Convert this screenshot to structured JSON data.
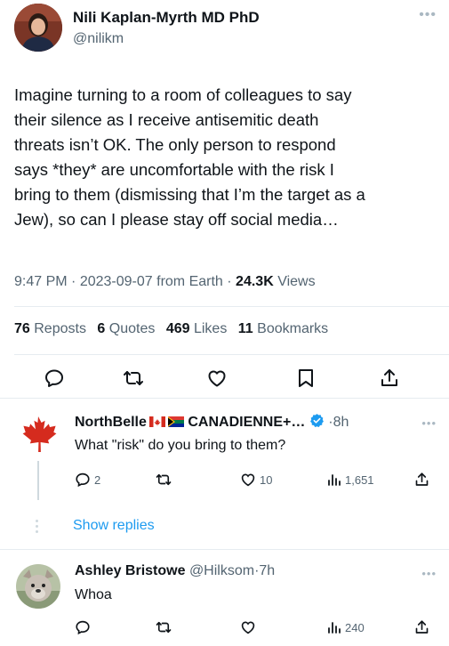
{
  "main_tweet": {
    "author_name": "Nili Kaplan-Myrth MD PhD",
    "author_handle": "@nilikm",
    "more_icon": "more-dots-icon",
    "text_lines": [
      "Imagine turning to a room of colleagues to say",
      "their silence as I receive antisemitic death",
      "threats isn’t OK. The only person to respond",
      "says *they* are uncomfortable with the risk I",
      "bring to them (dismissing that I’m the target as a",
      "Jew), so can I please stay off social media…"
    ],
    "time": "9:47 PM",
    "date": "2023-09-07",
    "source": "from Earth",
    "views_count": "24.3K",
    "views_label": "Views",
    "stats": [
      {
        "count": "76",
        "label": "Reposts"
      },
      {
        "count": "6",
        "label": "Quotes"
      },
      {
        "count": "469",
        "label": "Likes"
      },
      {
        "count": "11",
        "label": "Bookmarks"
      }
    ],
    "actions": [
      "reply-icon",
      "repost-icon",
      "like-icon",
      "bookmark-icon",
      "share-icon"
    ]
  },
  "replies": [
    {
      "name_prefix": "NorthBelle",
      "name_suffix": "CANADIENNE+…",
      "flags": [
        "canada-flag-icon",
        "south-africa-flag-icon"
      ],
      "verified": true,
      "separator": "·",
      "time": "8h",
      "text": "What \"risk\" do you bring to them?",
      "avatar_icon": "maple-leaf-icon",
      "actions": {
        "replies": "2",
        "reposts": "",
        "likes": "10",
        "views": "1,651"
      }
    },
    {
      "name": "Ashley Bristowe",
      "handle": "@Hilksom",
      "separator": "·",
      "time": "7h",
      "text": "Whoa",
      "avatar_icon": "bulldog-avatar-icon",
      "actions": {
        "replies": "",
        "reposts": "",
        "likes": "",
        "views": "240"
      }
    }
  ],
  "show_replies_label": "Show replies",
  "colors": {
    "accent": "#1d9bf0",
    "text": "#0f1419",
    "muted": "#536471",
    "divider": "#e6ecf0",
    "verified": "#1d9bf0",
    "maple": "#d52b1e"
  }
}
